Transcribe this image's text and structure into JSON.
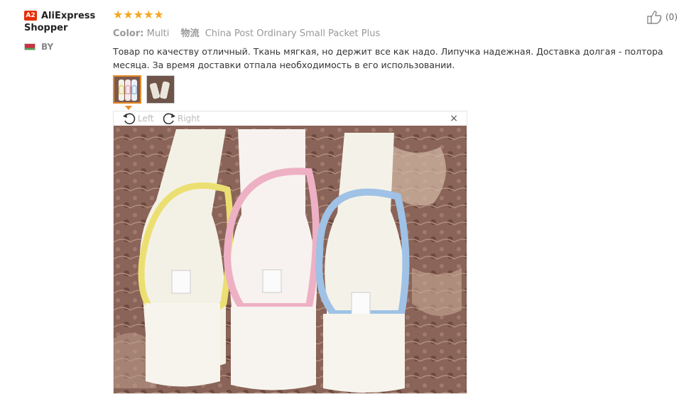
{
  "reviewer": {
    "avatar_text": "A2",
    "name": "AliExpress Shopper",
    "country": "BY"
  },
  "review": {
    "stars": "★★★★★",
    "color_label": "Color:",
    "color_value": "Multi",
    "logistics_label": "物流",
    "logistics_value": "China Post Ordinary Small Packet Plus",
    "text": "Товар по качеству отличный. Ткань мягкая, но держит все как надо. Липучка надежная. Доставка долгая - полтора месяца. За время доставки отпала необходимость в его использовании.",
    "like_count": "(0)"
  },
  "viewer": {
    "rotate_left": "Left",
    "rotate_right": "Right",
    "close": "×"
  },
  "colors": {
    "accent": "#e98b29",
    "star": "#f5a623",
    "badge": "#e62e04"
  },
  "icons": [
    "thumbs-up-icon",
    "rotate-left-icon",
    "rotate-right-icon",
    "close-icon",
    "star-icon",
    "flag-icon"
  ]
}
